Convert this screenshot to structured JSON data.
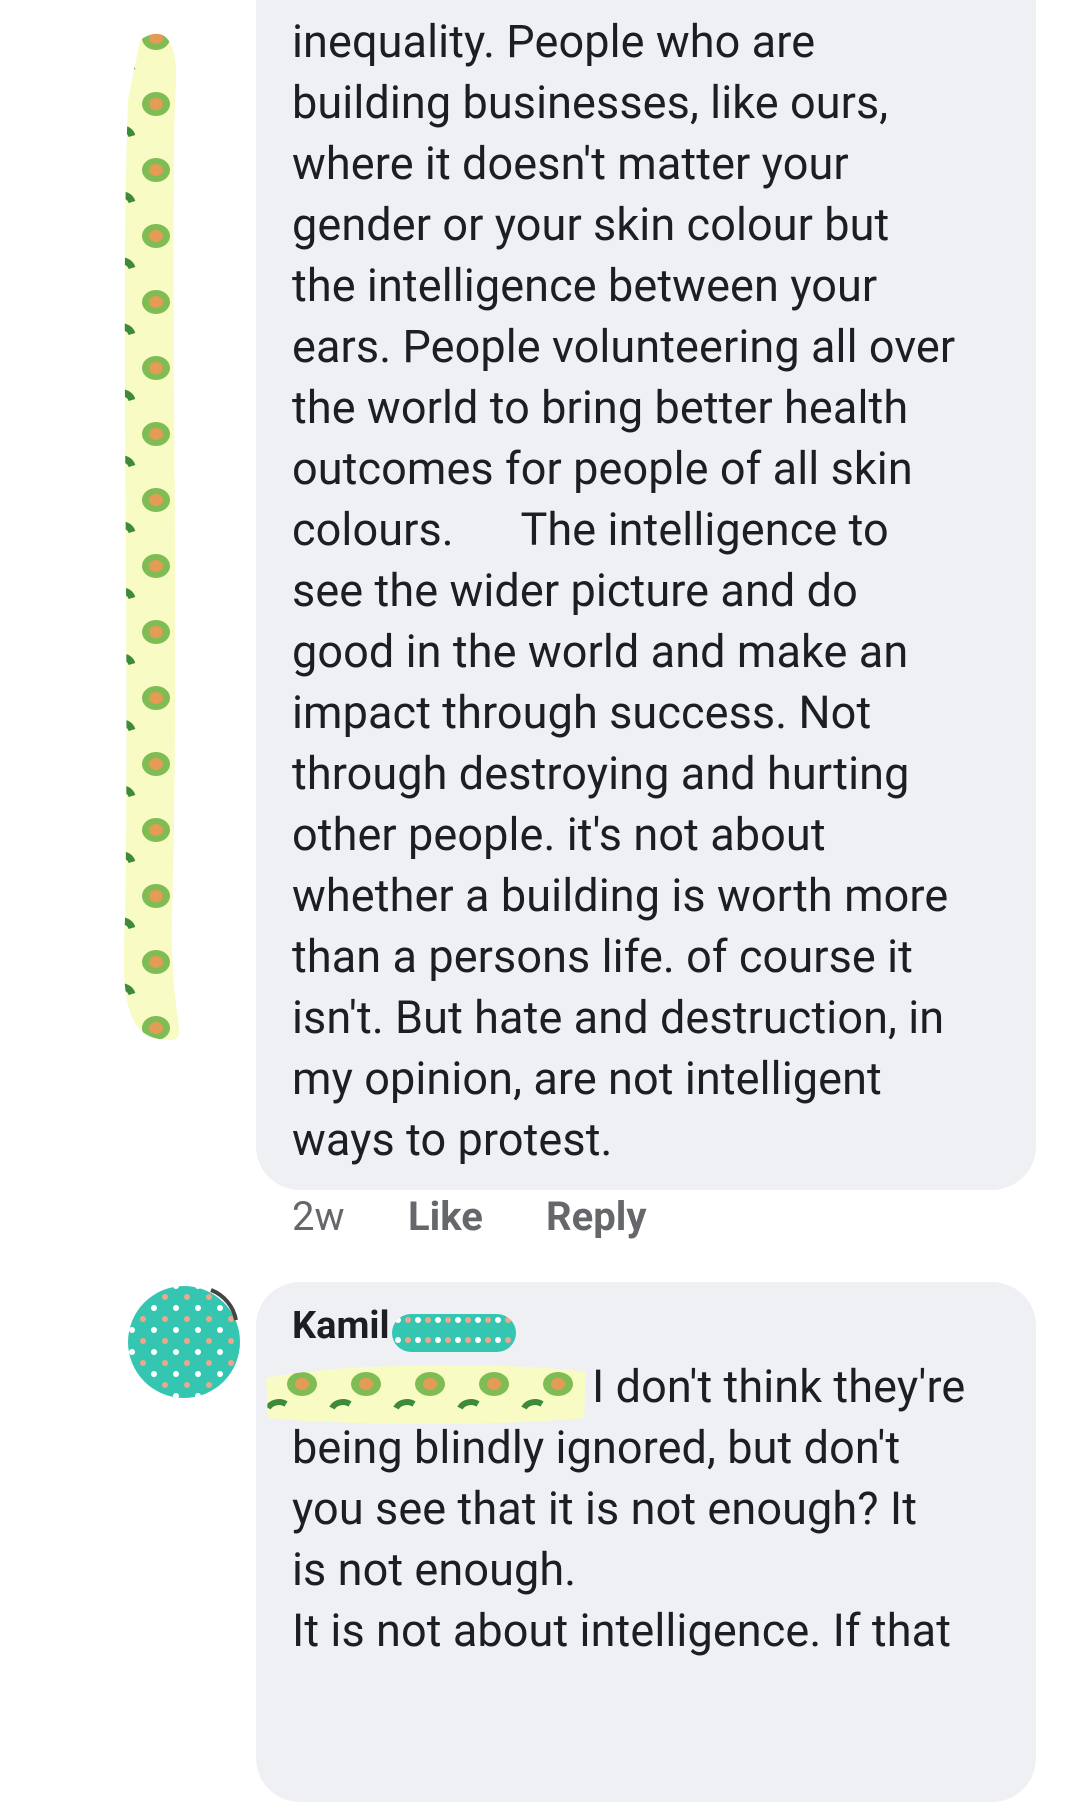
{
  "comment1": {
    "lines": [
      "inequality. People who are",
      "building businesses, like ours,",
      "where it doesn't matter your",
      "gender or your skin colour but",
      "the intelligence between your",
      "ears. People volunteering all over",
      "the world to bring better health",
      "outcomes for people of all skin",
      "colours.      The intelligence to",
      "see the wider picture and do",
      "good in the world and make an",
      "impact through success. Not",
      "through destroying and hurting",
      "other people. it's not about",
      "whether a building is worth more",
      "than a persons life. of course it",
      "isn't. But hate and destruction, in",
      "my opinion, are not intelligent",
      "ways to protest."
    ],
    "meta": {
      "time": "2w",
      "like": "Like",
      "reply": "Reply"
    }
  },
  "comment2": {
    "author_visible": "Kamil",
    "lines": [
      "I don't think they're",
      "being blindly ignored, but don't",
      "you see that it is not enough? It",
      "is not enough.",
      "It is not about intelligence. If that"
    ]
  },
  "colors": {
    "bubble": "#eff0f4",
    "text": "#1c1e21",
    "meta": "#65676b",
    "redaction_yellow": "#f8fbc4",
    "redaction_teal": "#35c6b2",
    "avocado_green": "#7fbd54",
    "avocado_pit": "#e39b56"
  }
}
